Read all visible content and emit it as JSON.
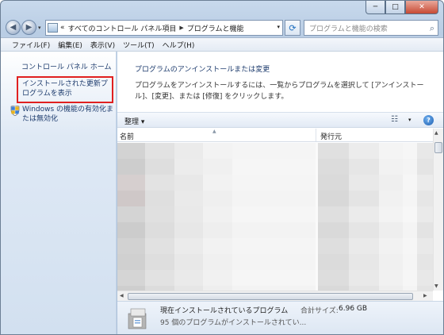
{
  "window": {
    "minimize": "─",
    "maximize": "□",
    "close": "✕"
  },
  "nav": {
    "address_prefix": "«",
    "breadcrumb": [
      "すべてのコントロール パネル項目",
      "プログラムと機能"
    ],
    "search_placeholder": "プログラムと機能の検索"
  },
  "menu": [
    "ファイル(F)",
    "編集(E)",
    "表示(V)",
    "ツール(T)",
    "ヘルプ(H)"
  ],
  "sidebar": {
    "home": "コントロール パネル ホーム",
    "installed_updates": "インストールされた更新プログラムを表示",
    "windows_features": "Windows の機能の有効化または無効化"
  },
  "main": {
    "title": "プログラムのアンインストールまたは変更",
    "description": "プログラムをアンインストールするには、一覧からプログラムを選択して [アンインストール]、[変更]、または [修復] をクリックします。"
  },
  "toolbar": {
    "organize": "整理 ▾",
    "views_icon": "☷",
    "views_dd": "▾",
    "help": "?"
  },
  "list": {
    "col_name": "名前",
    "col_publisher": "発行元",
    "rows": [
      {
        "shades": [
          "#d3d3d3",
          "#e2e2e2",
          "#ebebeb",
          "#f3f3f3",
          "#f5f5f5",
          "#e0e0e0",
          "#ececec",
          "#f4f4f4",
          "#f6f6f6",
          "#e8e8e8"
        ]
      },
      {
        "shades": [
          "#cdcdcd",
          "#dedede",
          "#ececec",
          "#f0f0f0",
          "#f6f6f6",
          "#dcdcdc",
          "#e6e6e6",
          "#f2f2f2",
          "#f4f4f4",
          "#e4e4e4"
        ]
      },
      {
        "shades": [
          "#d6cfcf",
          "#e3e3e3",
          "#e8e8e8",
          "#f2f2f2",
          "#f5f5f5",
          "#dadada",
          "#e9e9e9",
          "#efefef",
          "#f6f6f6",
          "#ebebeb"
        ]
      },
      {
        "shades": [
          "#cfc8c8",
          "#dfdfdf",
          "#eaeaea",
          "#efefef",
          "#f4f4f4",
          "#d8d8d8",
          "#e4e4e4",
          "#f1f1f1",
          "#f5f5f5",
          "#e6e6e6"
        ]
      },
      {
        "shades": [
          "#d4d4d4",
          "#e0e0e0",
          "#e9e9e9",
          "#f1f1f1",
          "#f6f6f6",
          "#dfdfdf",
          "#ebebeb",
          "#f3f3f3",
          "#f7f7f7",
          "#eaeaea"
        ]
      },
      {
        "shades": [
          "#cccccc",
          "#dddddd",
          "#e7e7e7",
          "#eeeeee",
          "#f3f3f3",
          "#d9d9d9",
          "#e5e5e5",
          "#eeeeee",
          "#f4f4f4",
          "#e3e3e3"
        ]
      },
      {
        "shades": [
          "#d2d2d2",
          "#e1e1e1",
          "#ebebeb",
          "#f2f2f2",
          "#f5f5f5",
          "#dedede",
          "#eaeaea",
          "#f2f2f2",
          "#f6f6f6",
          "#e9e9e9"
        ]
      },
      {
        "shades": [
          "#d0d0d0",
          "#dedede",
          "#e8e8e8",
          "#f0f0f0",
          "#f4f4f4",
          "#dbdbdb",
          "#e7e7e7",
          "#f0f0f0",
          "#f5f5f5",
          "#e5e5e5"
        ]
      },
      {
        "shades": [
          "#d5d5d5",
          "#e2e2e2",
          "#eaeaea",
          "#f1f1f1",
          "#f6f6f6",
          "#dddddd",
          "#e9e9e9",
          "#f1f1f1",
          "#f6f6f6",
          "#e8e8e8"
        ]
      },
      {
        "shades": [
          "#cecece",
          "#dcdcdc",
          "#e6e6e6",
          "#eeeeee",
          "#f3f3f3",
          "#d9d9d9",
          "#e4e4e4",
          "#eeeeee",
          "#f4f4f4",
          "#e4e4e4"
        ]
      }
    ]
  },
  "status": {
    "title": "現在インストールされているプログラム",
    "size_label": "合計サイズ:",
    "size_value": "6.96 GB",
    "count": "95 個のプログラムがインストールされてい..."
  }
}
